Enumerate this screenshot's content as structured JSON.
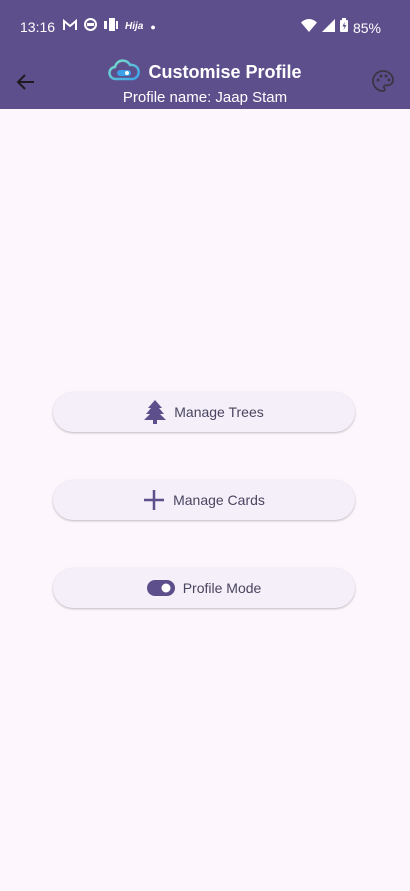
{
  "status_bar": {
    "time": "13:16",
    "notification_icons": [
      "gmail-icon",
      "app-icon",
      "app-icon",
      "hija-icon",
      "dot-icon"
    ],
    "battery": "85%"
  },
  "appbar": {
    "title": "Customise Profile",
    "subtitle": "Profile name: Jaap Stam",
    "colors": {
      "background": "#5d4f8c",
      "text": "#ffffff"
    }
  },
  "actions": [
    {
      "label": "Manage Trees",
      "icon": "tree-icon"
    },
    {
      "label": "Manage Cards",
      "icon": "plus-icon"
    },
    {
      "label": "Profile Mode",
      "icon": "toggle-icon"
    }
  ],
  "colors": {
    "page_background": "#fdf7fd",
    "button_background": "#f4eff8",
    "accent": "#5d4f8c"
  }
}
